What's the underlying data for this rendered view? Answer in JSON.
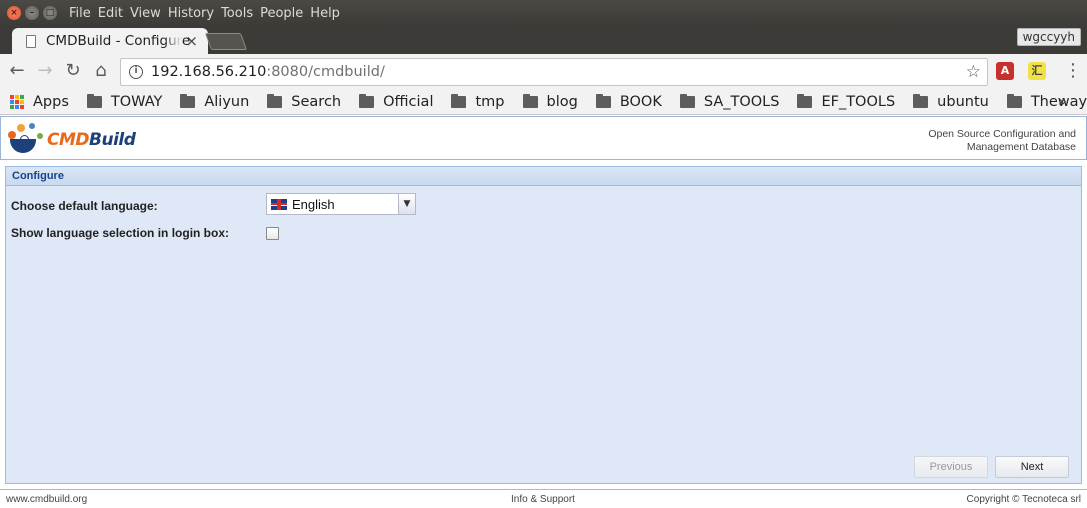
{
  "os": {
    "menu": [
      "File",
      "Edit",
      "View",
      "History",
      "Tools",
      "People",
      "Help"
    ]
  },
  "browser": {
    "tab_title": "CMDBuild - Configure",
    "profile_name": "wgccyyh",
    "url_host": "192.168.56.210",
    "url_rest": ":8080/cmdbuild/",
    "extensions": [
      "A",
      "汇"
    ],
    "bookmarks_apps": "Apps",
    "bookmarks": [
      "TOWAY",
      "Aliyun",
      "Search",
      "Official",
      "tmp",
      "blog",
      "BOOK",
      "SA_TOOLS",
      "EF_TOOLS",
      "ubuntu",
      "Theway"
    ],
    "more_bookmarks": "»",
    "apps_colors": [
      "#ea4335",
      "#fbbc05",
      "#34a853",
      "#4285f4",
      "#ea4335",
      "#fbbc05",
      "#34a853",
      "#4285f4",
      "#ea4335"
    ]
  },
  "app": {
    "logo_prefix": "CMD",
    "logo_suffix": "Build",
    "tagline_line1": "Open Source Configuration and",
    "tagline_line2": "Management Database",
    "panel_title": "Configure",
    "language_label": "Choose default language:",
    "language_value": "English",
    "show_language_label": "Show language selection in login box:",
    "show_language_checked": false,
    "previous_label": "Previous",
    "next_label": "Next",
    "footer_left": "www.cmdbuild.org",
    "footer_mid": "Info & Support",
    "footer_right": "Copyright © Tecnoteca srl"
  }
}
